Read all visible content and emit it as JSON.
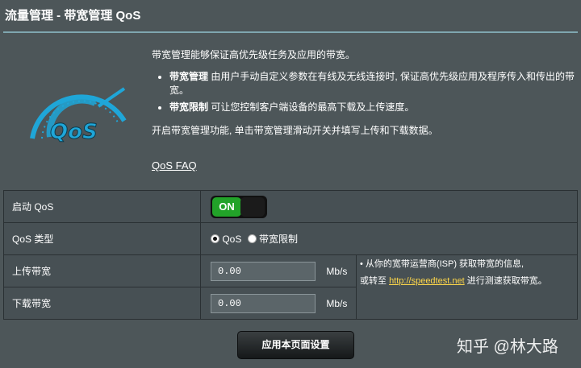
{
  "header": {
    "title": "流量管理 - 带宽管理 QoS"
  },
  "logo": {
    "text": "QoS",
    "icon": "speedometer-icon"
  },
  "description": {
    "intro": "带宽管理能够保证高优先级任务及应用的带宽。",
    "bullets": [
      {
        "bold": "带宽管理",
        "text": " 由用户手动自定义参数在有线及无线连接时, 保证高优先级应用及程序传入和传出的带宽。"
      },
      {
        "bold": "带宽限制",
        "text": " 可让您控制客户端设备的最高下载及上传速度。"
      }
    ],
    "instruction": "开启带宽管理功能, 单击带宽管理滑动开关并填写上传和下载数据。",
    "faq_link": "QoS FAQ"
  },
  "settings": {
    "enable_label": "启动 QoS",
    "toggle_state": "ON",
    "type_label": "QoS 类型",
    "type_options": [
      "QoS",
      "带宽限制"
    ],
    "type_selected": "QoS",
    "upload_label": "上传带宽",
    "upload_value": "0.00",
    "download_label": "下载带宽",
    "download_value": "0.00",
    "unit": "Mb/s"
  },
  "note": {
    "part1": "从你的宽带运营商(ISP) 获取带宽的信息,",
    "part2": "或转至 ",
    "link": "http://speedtest.net",
    "part3": " 进行测速获取带宽。"
  },
  "apply_button": "应用本页面设置",
  "watermark": "知乎 @林大路",
  "colors": {
    "accent": "#22a329",
    "link": "#ffd84a",
    "logo": "#1fa6d8"
  }
}
